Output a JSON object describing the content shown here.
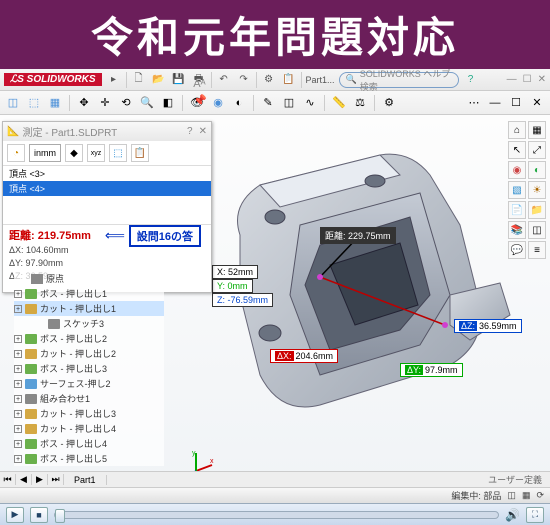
{
  "banner": "令和元年問題対応",
  "app": {
    "logo": "SOLIDWORKS",
    "doc": "Part1...",
    "search_placeholder": "SOLIDWORKS ヘルプ検索"
  },
  "panel": {
    "title": "測定 - Part1.SLDPRT",
    "mode_in": "in",
    "mode_mm": "mm",
    "items": [
      "頂点 <3>",
      "頂点 <4>"
    ],
    "result_main": "距離: 219.75mm",
    "result_r2": "ΔX: 104.60mm",
    "result_r3": "ΔY: 97.90mm",
    "result_r4": "ΔZ: 36.59mm",
    "answer_label": "設問16の答",
    "aa": "Aᴬ",
    "xyz": "xyz"
  },
  "tree": {
    "root": "原点",
    "items": [
      {
        "label": "ボス - 押し出し1",
        "kind": "extrude"
      },
      {
        "label": "カット - 押し出し1",
        "kind": "cut",
        "sel": true
      },
      {
        "label": "スケッチ3",
        "kind": "sketch",
        "indent": true
      },
      {
        "label": "ボス - 押し出し2",
        "kind": "extrude"
      },
      {
        "label": "カット - 押し出し2",
        "kind": "cut"
      },
      {
        "label": "ボス - 押し出し3",
        "kind": "extrude"
      },
      {
        "label": "サーフェス-押し2",
        "kind": "surf"
      },
      {
        "label": "組み合わせ1",
        "kind": "combine"
      },
      {
        "label": "カット - 押し出し3",
        "kind": "cut"
      },
      {
        "label": "カット - 押し出し4",
        "kind": "cut"
      },
      {
        "label": "ボス - 押し出し4",
        "kind": "extrude"
      },
      {
        "label": "ボス - 押し出し5",
        "kind": "extrude"
      }
    ]
  },
  "callouts": {
    "distance_label": "距離:",
    "distance_val": "229.75mm",
    "x": "52mm",
    "y": "0mm",
    "z": "-76.59mm",
    "dx": "204.6mm",
    "dy": "97.9mm",
    "dz": "36.59mm"
  },
  "status": {
    "tab": "Part1",
    "mode": "編集中: 部品",
    "menu": "ユーザー定義"
  },
  "chart_data": null
}
